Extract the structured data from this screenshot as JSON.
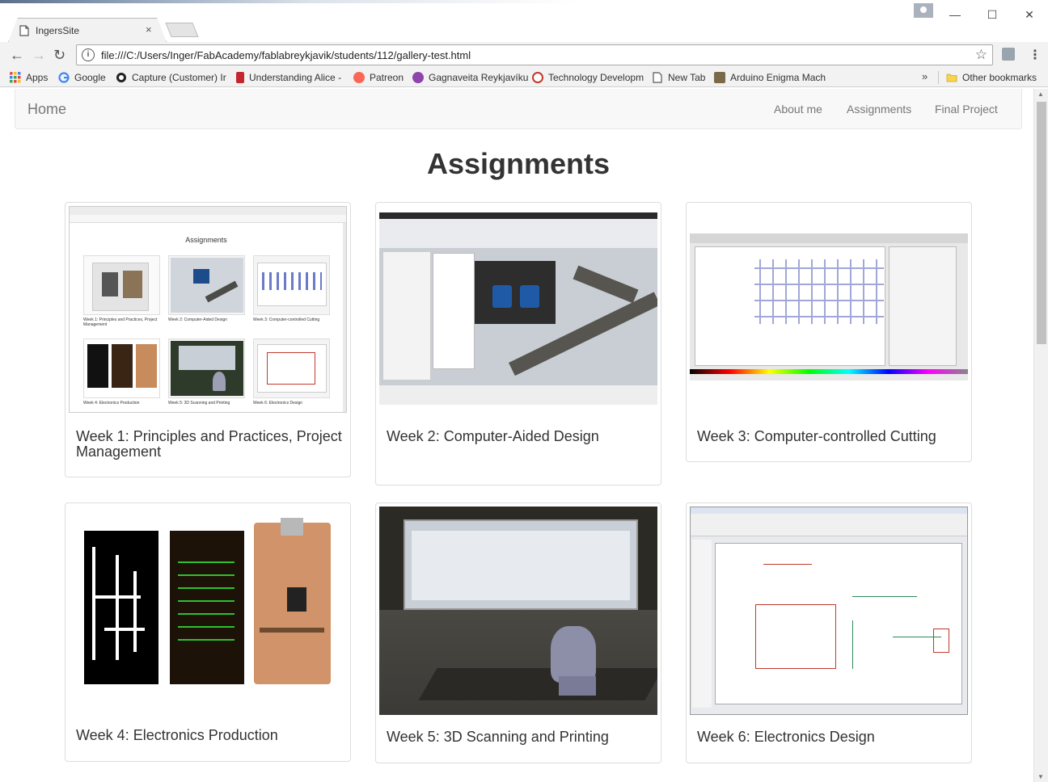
{
  "browser": {
    "tab_title": "IngersSite",
    "url": "file:///C:/Users/Inger/FabAcademy/fablabreykjavik/students/112/gallery-test.html",
    "window_controls": {
      "minimize": "—",
      "maximize": "☐",
      "close": "✕"
    },
    "icons": {
      "back": "←",
      "forward": "→",
      "reload": "↻",
      "star": "☆",
      "menu": "⋮",
      "info": "i",
      "chevron": "»",
      "tab_close": "×"
    }
  },
  "bookmarks": {
    "items": [
      {
        "label": "Apps",
        "icon": "apps-grid-icon",
        "color": "#e8453c"
      },
      {
        "label": "Google",
        "icon": "google-icon",
        "color": "#4285f4"
      },
      {
        "label": "Capture (Customer) Ir",
        "icon": "capture-icon",
        "color": "#222222"
      },
      {
        "label": "Understanding Alice -",
        "icon": "alice-icon",
        "color": "#c2272d"
      },
      {
        "label": "Patreon",
        "icon": "patreon-icon",
        "color": "#f96854"
      },
      {
        "label": "Gagnaveita Reykjavíku",
        "icon": "gagnaveita-icon",
        "color": "#8e44ad"
      },
      {
        "label": "Technology Developm",
        "icon": "technology-icon",
        "color": "#c0392b"
      },
      {
        "label": "New Tab",
        "icon": "page-icon",
        "color": "#ffffff"
      },
      {
        "label": "Arduino Enigma Mach",
        "icon": "arduino-icon",
        "color": "#7a6a4a"
      }
    ],
    "other": "Other bookmarks"
  },
  "nav": {
    "home": "Home",
    "links": [
      "About me",
      "Assignments",
      "Final Project"
    ]
  },
  "page": {
    "title": "Assignments"
  },
  "cards": [
    {
      "caption": "Week 1: Principles and Practices, Project Management"
    },
    {
      "caption": "Week 2: Computer-Aided Design"
    },
    {
      "caption": "Week 3: Computer-controlled Cutting"
    },
    {
      "caption": "Week 4: Electronics Production"
    },
    {
      "caption": "Week 5: 3D Scanning and Printing"
    },
    {
      "caption": "Week 6: Electronics Design"
    }
  ],
  "thumb_week1": {
    "title": "Assignments",
    "captions": [
      "Week 1: Principles and Practices, Project Management",
      "Week 2: Computer-Aided Design",
      "Week 3: Computer-controlled Cutting",
      "Week 4: Electronics Production",
      "Week 5: 3D Scanning and Printing",
      "Week 6: Electronics Design"
    ]
  }
}
